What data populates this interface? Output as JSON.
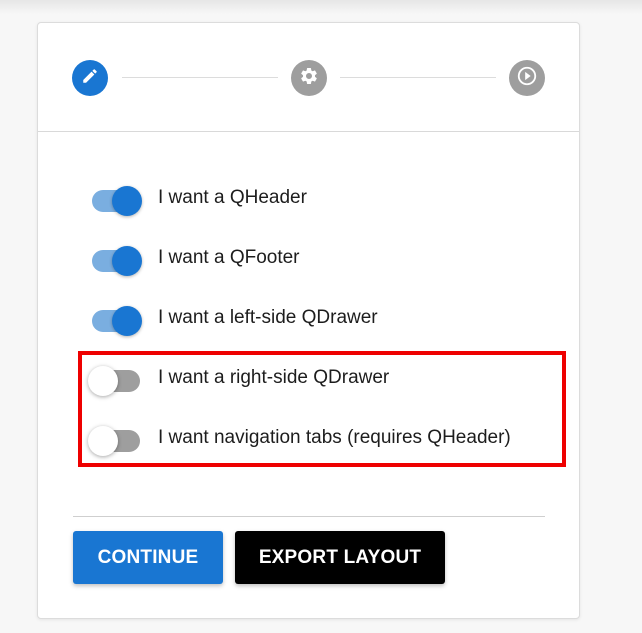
{
  "stepper": {
    "steps": [
      {
        "icon": "pencil-icon",
        "state": "active"
      },
      {
        "icon": "gear-icon",
        "state": "inactive"
      },
      {
        "icon": "play-circle-icon",
        "state": "inactive"
      }
    ]
  },
  "options": [
    {
      "label": "I want a QHeader",
      "checked": true
    },
    {
      "label": "I want a QFooter",
      "checked": true
    },
    {
      "label": "I want a left-side QDrawer",
      "checked": true
    },
    {
      "label": "I want a right-side QDrawer",
      "checked": false
    },
    {
      "label": "I want navigation tabs (requires QHeader)",
      "checked": false
    }
  ],
  "actions": {
    "continue_label": "CONTINUE",
    "export_label": "EXPORT LAYOUT"
  },
  "colors": {
    "primary": "#1976d2",
    "inactive": "#9e9e9e",
    "highlight": "#ee0000",
    "export_bg": "#000000"
  }
}
